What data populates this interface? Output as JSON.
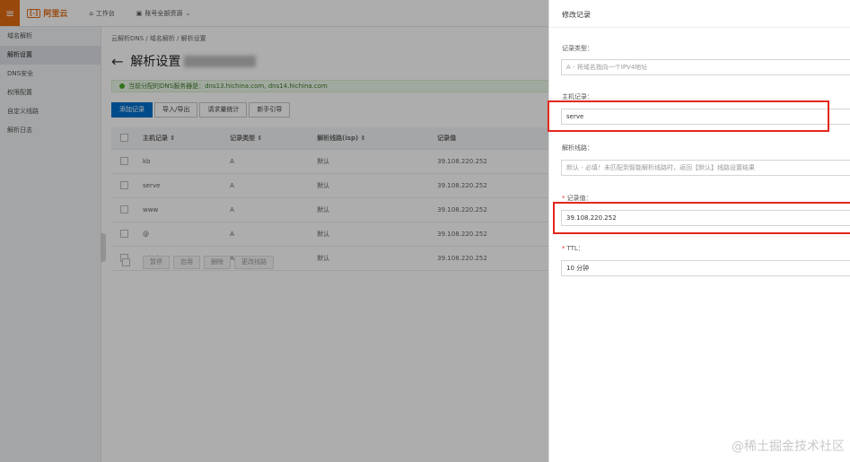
{
  "topbar": {
    "logo_text": "阿里云",
    "workbench": "工作台",
    "region": "账号全部资源"
  },
  "sidebar": {
    "items": [
      "域名解析",
      "解析设置",
      "DNS安全",
      "权限配置",
      "自定义线路",
      "解析日志"
    ]
  },
  "main": {
    "breadcrumb": "云解析DNS / 域名解析 / 解析设置",
    "title": "解析设置",
    "notice": "当前分配的DNS服务器是：dns13.hichina.com, dns14.hichina.com",
    "toolbar": [
      "添加记录",
      "导入/导出",
      "请求量统计",
      "新手引导"
    ],
    "columns": [
      "主机记录 ⇕",
      "记录类型 ⇕",
      "解析线路(isp) ⇕",
      "记录值"
    ],
    "rows": [
      [
        "kb",
        "A",
        "默认",
        "39.108.220.252"
      ],
      [
        "serve",
        "A",
        "默认",
        "39.108.220.252"
      ],
      [
        "www",
        "A",
        "默认",
        "39.108.220.252"
      ],
      [
        "@",
        "A",
        "默认",
        "39.108.220.252"
      ],
      [
        "admin",
        "A",
        "默认",
        "39.108.220.252"
      ]
    ],
    "bottom_buttons": [
      "暂停",
      "启用",
      "删除",
      "更改线路"
    ]
  },
  "panel": {
    "title": "修改记录",
    "record_type_label": "记录类型：",
    "record_type_value": "A - 将域名指向一个IPV4地址",
    "host_label": "主机记录：",
    "host_value": "serve",
    "line_label": "解析线路：",
    "line_value": "默认 - 必填！未匹配到智能解析线路时，返回【默认】线路设置结果",
    "value_label": "记录值：",
    "value_value": "39.108.220.252",
    "ttl_label": "TTL：",
    "ttl_value": "10 分钟"
  },
  "watermark": "@稀土掘金技术社区"
}
